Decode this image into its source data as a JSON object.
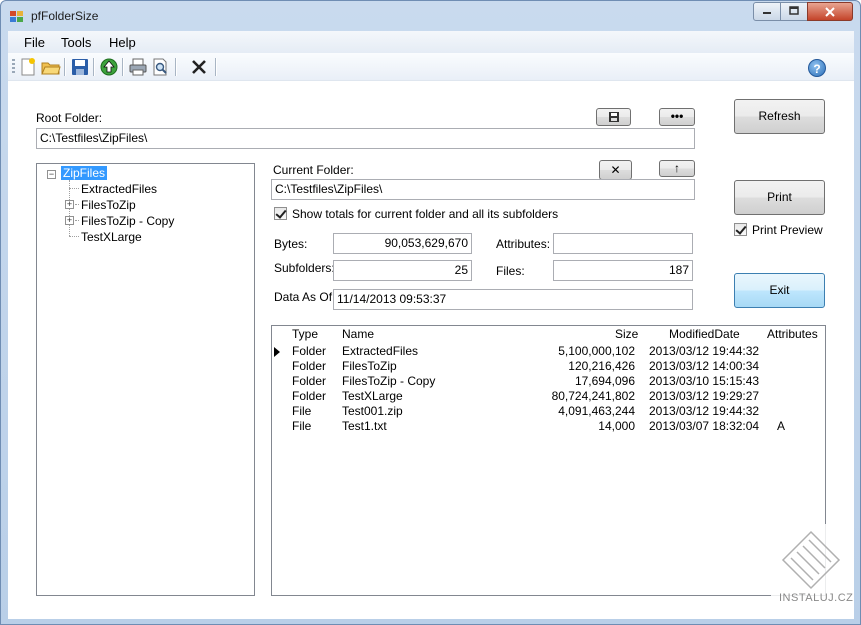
{
  "window": {
    "title": "pfFolderSize"
  },
  "menu": [
    "File",
    "Tools",
    "Help"
  ],
  "toolbar": {
    "icons": [
      "new-icon",
      "open-folder-icon",
      "save-icon",
      "up-arrow-icon",
      "print-icon",
      "print-preview-icon",
      "delete-x-icon"
    ],
    "help_label": "?"
  },
  "root_folder": {
    "label": "Root Folder:",
    "value": "C:\\Testfiles\\ZipFiles\\",
    "browse_label": "•••"
  },
  "tree": {
    "root": "ZipFiles",
    "children": [
      "ExtractedFiles",
      "FilesToZip",
      "FilesToZip - Copy",
      "TestXLarge"
    ]
  },
  "current_folder": {
    "label": "Current Folder:",
    "value": "C:\\Testfiles\\ZipFiles\\",
    "clear_label": "✕",
    "up_label": "↑"
  },
  "show_totals_label": "Show totals for current folder and all its subfolders",
  "stats": {
    "bytes_label": "Bytes:",
    "bytes_value": "90,053,629,670",
    "attributes_label": "Attributes:",
    "attributes_value": "",
    "subfolders_label": "Subfolders:",
    "subfolders_value": "25",
    "files_label": "Files:",
    "files_value": "187",
    "data_as_of_label": "Data As Of:",
    "data_as_of_value": "11/14/2013 09:53:37"
  },
  "buttons": {
    "refresh": "Refresh",
    "print": "Print",
    "print_preview": "Print Preview",
    "exit": "Exit"
  },
  "grid": {
    "columns": [
      "Type",
      "Name",
      "Size",
      "ModifiedDate",
      "Attributes"
    ],
    "rows": [
      {
        "type": "Folder",
        "name": "ExtractedFiles",
        "size": "5,100,000,102",
        "date": "2013/03/12 19:44:32",
        "attr": ""
      },
      {
        "type": "Folder",
        "name": "FilesToZip",
        "size": "120,216,426",
        "date": "2013/03/12 14:00:34",
        "attr": ""
      },
      {
        "type": "Folder",
        "name": "FilesToZip - Copy",
        "size": "17,694,096",
        "date": "2013/03/10 15:15:43",
        "attr": ""
      },
      {
        "type": "Folder",
        "name": "TestXLarge",
        "size": "80,724,241,802",
        "date": "2013/03/12 19:29:27",
        "attr": ""
      },
      {
        "type": "File",
        "name": "Test001.zip",
        "size": "4,091,463,244",
        "date": "2013/03/12 19:44:32",
        "attr": ""
      },
      {
        "type": "File",
        "name": "Test1.txt",
        "size": "14,000",
        "date": "2013/03/07 18:32:04",
        "attr": "A"
      }
    ]
  },
  "watermark": "INSTALUJ.CZ"
}
